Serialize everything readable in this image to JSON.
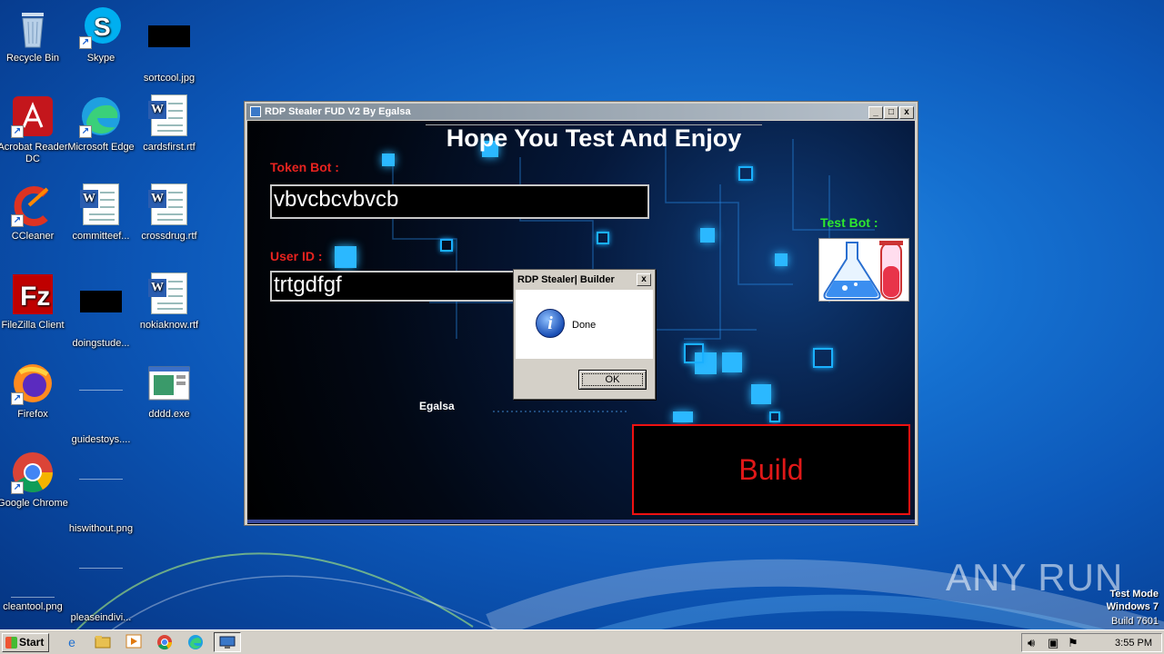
{
  "desktop": {
    "icons": [
      {
        "label": "Recycle Bin"
      },
      {
        "label": "Skype"
      },
      {
        "label": "sortcool.jpg"
      },
      {
        "label": "Acrobat Reader DC"
      },
      {
        "label": "Microsoft Edge"
      },
      {
        "label": "cardsfirst.rtf"
      },
      {
        "label": "CCleaner"
      },
      {
        "label": "committeef..."
      },
      {
        "label": "crossdrug.rtf"
      },
      {
        "label": "FileZilla Client"
      },
      {
        "label": "doingstude..."
      },
      {
        "label": "nokiaknow.rtf"
      },
      {
        "label": "Firefox"
      },
      {
        "label": "guidestoys...."
      },
      {
        "label": "dddd.exe"
      },
      {
        "label": "Google Chrome"
      },
      {
        "label": "hiswithout.png"
      },
      {
        "label": "cleantool.png"
      },
      {
        "label": "pleaseindivi..."
      }
    ]
  },
  "app": {
    "title": "RDP Stealer FUD V2 By Egalsa",
    "heading": "Hope You Test And Enjoy",
    "token_label": "Token Bot :",
    "token_value": "vbvcbcvbvcb",
    "userid_label": "User ID :",
    "userid_value": "trtgdfgf",
    "testbot_label": "Test Bot :",
    "author": "Egalsa",
    "build_label": "Build",
    "minimize": "_",
    "maximize": "□",
    "close": "x"
  },
  "dialog": {
    "title": "RDP Stealer| Builder",
    "close": "x",
    "message": "Done",
    "ok_label": "OK",
    "icon": "info-icon"
  },
  "taskbar": {
    "start_label": "Start",
    "clock": "3:55 PM"
  },
  "watermark": {
    "line1": "Test Mode",
    "line2": "Windows 7",
    "line3": "Build 7601",
    "brand": "ANY RUN"
  },
  "colors": {
    "token_label": "#e8231f",
    "testbot_label": "#2ee82e",
    "build_text": "#e01818",
    "accent_cyan": "#2bb8ff"
  }
}
